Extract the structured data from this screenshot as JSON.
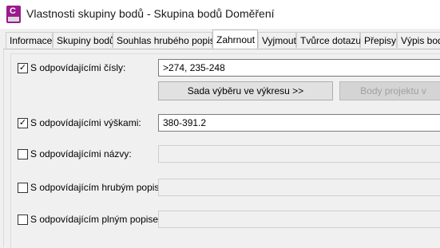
{
  "window": {
    "title": "Vlastnosti skupiny bodů - Skupina bodů Doměření",
    "icon_letter": "C"
  },
  "tabs": [
    {
      "label": "Informace"
    },
    {
      "label": "Skupiny bodů"
    },
    {
      "label": "Souhlas hrubého popisu"
    },
    {
      "label": "Zahrnout",
      "active": true
    },
    {
      "label": "Vyjmout"
    },
    {
      "label": "Tvůrce dotazu"
    },
    {
      "label": "Přepisy"
    },
    {
      "label": "Výpis bodů"
    }
  ],
  "rows": [
    {
      "label": "S odpovídajícími čísly:",
      "checked": true,
      "value": ">274, 235-248"
    },
    {
      "label": "S odpovídajícími výškami:",
      "checked": true,
      "value": "380-391.2"
    },
    {
      "label": "S odpovídajícími názvy:",
      "checked": false,
      "value": ""
    },
    {
      "label": "S odpovídajícím hrubým popisem:",
      "checked": false,
      "value": ""
    },
    {
      "label": "S odpovídajícím plným popisem:",
      "checked": false,
      "value": ""
    }
  ],
  "buttons": {
    "selection_set": "Sada výběru ve výkresu >>",
    "project_points": "Body projektu v"
  },
  "colors": {
    "app_icon": "#9b1b8e",
    "window_bg": "#f0f0f0",
    "active_tab": "#ffffff"
  }
}
